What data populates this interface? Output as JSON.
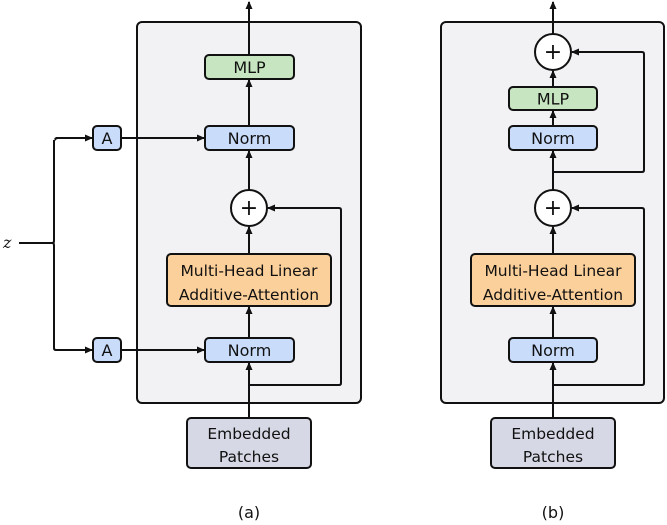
{
  "input_variable": "z",
  "colors": {
    "panel_fill": "#f2f2f4",
    "mlp_fill": "#c6e5c0",
    "norm_fill": "#c9dcfa",
    "attention_fill": "#fcd09a",
    "embedded_fill": "#d6d9e5",
    "stroke": "#111111"
  },
  "panel_a": {
    "caption": "(a)",
    "mlp": "MLP",
    "norm_top": "Norm",
    "plus": "+",
    "attention_line1": "Multi-Head Linear",
    "attention_line2": "Additive-Attention",
    "norm_bottom": "Norm",
    "adapter_top": "A",
    "adapter_bottom": "A",
    "embedded_line1": "Embedded",
    "embedded_line2": "Patches"
  },
  "panel_b": {
    "caption": "(b)",
    "plus_top": "+",
    "mlp": "MLP",
    "norm_top": "Norm",
    "plus_bottom": "+",
    "attention_line1": "Multi-Head Linear",
    "attention_line2": "Additive-Attention",
    "norm_bottom": "Norm",
    "embedded_line1": "Embedded",
    "embedded_line2": "Patches"
  }
}
